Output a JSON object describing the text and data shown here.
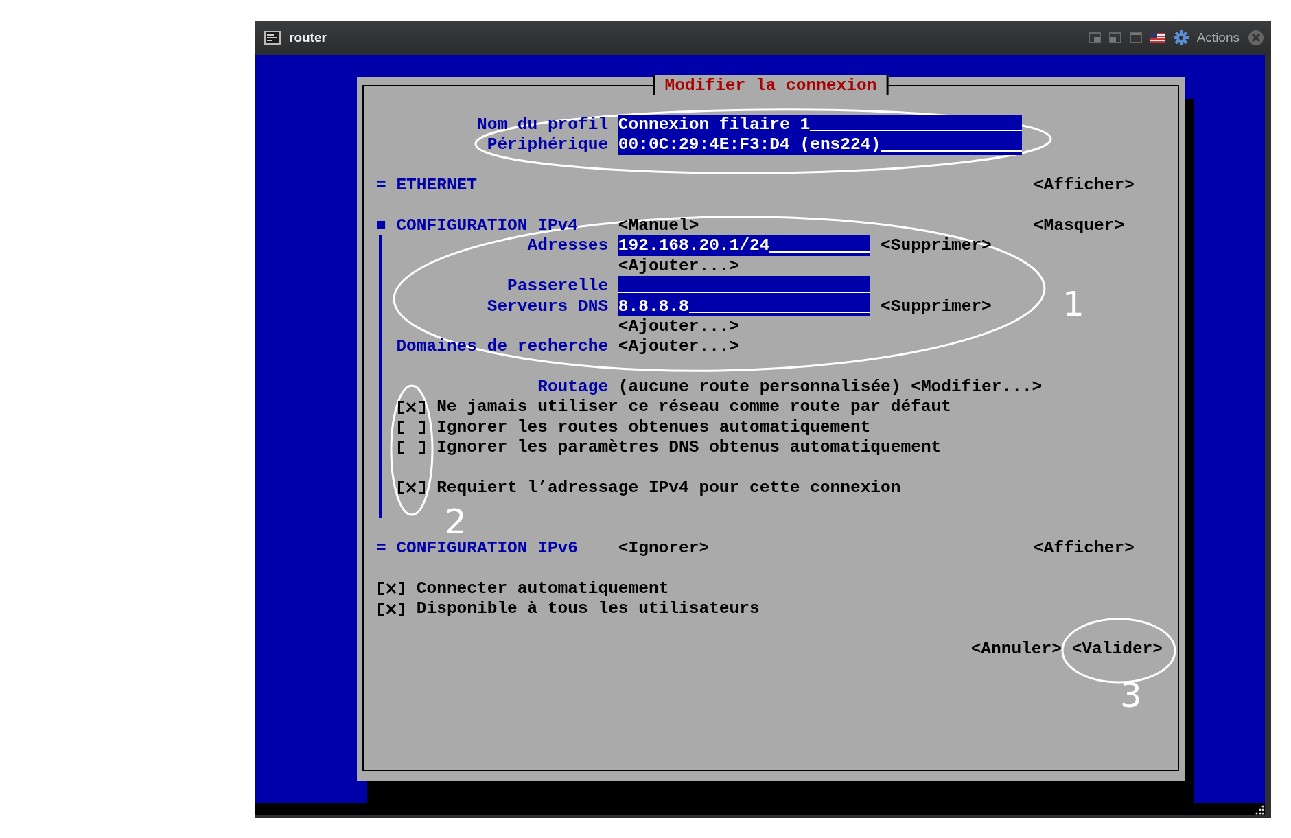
{
  "window": {
    "title": "router",
    "actions_label": "Actions"
  },
  "dialog": {
    "title": "Modifier la connexion",
    "fields": [
      {
        "label": "Nom du profil",
        "value": "Connexion filaire 1"
      },
      {
        "label": "Périphérique",
        "value": "00:0C:29:4E:F3:D4 (ens224)"
      }
    ],
    "sections": [
      {
        "marker": "=",
        "title": "ETHERNET",
        "toggle": "<Afficher>"
      },
      {
        "marker": "■",
        "title": "CONFIGURATION IPv4",
        "mode": "<Manuel>",
        "toggle": "<Masquer>",
        "rows": [
          {
            "kind": "field",
            "label": "Adresses",
            "value": "192.168.20.1/24",
            "action": "<Supprimer>"
          },
          {
            "kind": "button",
            "button": "<Ajouter...>"
          },
          {
            "kind": "field",
            "label": "Passerelle"
          },
          {
            "kind": "field",
            "label": "Serveurs DNS",
            "value": "8.8.8.8",
            "action": "<Supprimer>"
          },
          {
            "kind": "button",
            "button": "<Ajouter...>"
          },
          {
            "kind": "button",
            "label": "Domaines de recherche",
            "button": "<Ajouter...>"
          },
          {
            "kind": "blank"
          },
          {
            "kind": "text",
            "label": "Routage",
            "text": "(aucune route personnalisée)",
            "button": "<Modifier...>"
          },
          {
            "kind": "checkbox",
            "checked": true,
            "text": "Ne jamais utiliser ce réseau comme route par défaut"
          },
          {
            "kind": "checkbox",
            "checked": false,
            "text": "Ignorer les routes obtenues automatiquement"
          },
          {
            "kind": "checkbox",
            "checked": false,
            "text": "Ignorer les paramètres DNS obtenus automatiquement"
          },
          {
            "kind": "blank"
          },
          {
            "kind": "checkbox",
            "checked": true,
            "text": "Requiert l’adressage IPv4 pour cette connexion"
          },
          {
            "kind": "blank"
          }
        ]
      },
      {
        "marker": "=",
        "title": "CONFIGURATION IPv6",
        "mode": "<Ignorer>",
        "toggle": "<Afficher>"
      }
    ],
    "options": [
      {
        "checked": true,
        "text": "Connecter automatiquement"
      },
      {
        "checked": true,
        "text": "Disponible à tous les utilisateurs"
      }
    ],
    "buttons": [
      "<Annuler>",
      "<Valider>"
    ]
  },
  "annotations": [
    {
      "number": "1"
    },
    {
      "number": "2"
    },
    {
      "number": "3"
    }
  ]
}
